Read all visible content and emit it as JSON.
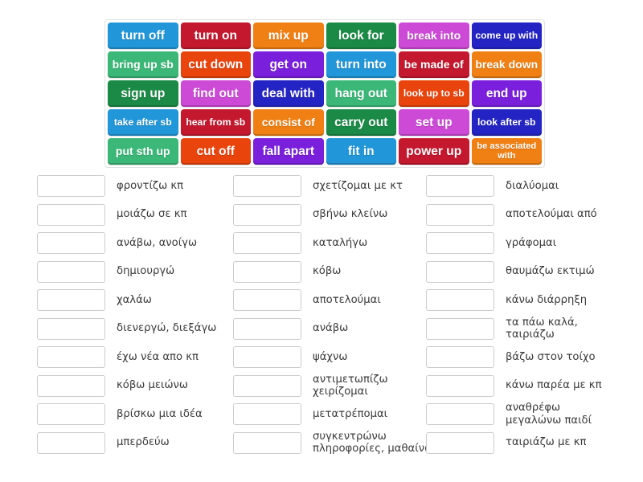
{
  "tile_grid": {
    "name": "phrasal-verbs-tile-grid",
    "rows": [
      [
        {
          "label": "turn off",
          "color": "#2196d8",
          "size": "lg"
        },
        {
          "label": "turn on",
          "color": "#c4182e",
          "size": "lg"
        },
        {
          "label": "mix up",
          "color": "#f08013",
          "size": "lg"
        },
        {
          "label": "look for",
          "color": "#1b8a46",
          "size": "lg"
        },
        {
          "label": "break into",
          "color": "#cc4ad6",
          "size": "md"
        },
        {
          "label": "come up with",
          "color": "#2424c4",
          "size": "sm"
        }
      ],
      [
        {
          "label": "bring up sb",
          "color": "#3bb878",
          "size": "md"
        },
        {
          "label": "cut down",
          "color": "#ea440d",
          "size": "lg"
        },
        {
          "label": "get on",
          "color": "#7a1fdb",
          "size": "lg"
        },
        {
          "label": "turn into",
          "color": "#2196d8",
          "size": "lg"
        },
        {
          "label": "be made of",
          "color": "#c4182e",
          "size": "md"
        },
        {
          "label": "break down",
          "color": "#f08013",
          "size": "md"
        }
      ],
      [
        {
          "label": "sign up",
          "color": "#1b8a46",
          "size": "lg"
        },
        {
          "label": "find out",
          "color": "#cc4ad6",
          "size": "lg"
        },
        {
          "label": "deal with",
          "color": "#2424c4",
          "size": "lg"
        },
        {
          "label": "hang out",
          "color": "#3bb878",
          "size": "lg"
        },
        {
          "label": "look up to sb",
          "color": "#ea440d",
          "size": "sm"
        },
        {
          "label": "end up",
          "color": "#7a1fdb",
          "size": "lg"
        }
      ],
      [
        {
          "label": "take after sb",
          "color": "#2196d8",
          "size": "sm"
        },
        {
          "label": "hear from sb",
          "color": "#c4182e",
          "size": "sm"
        },
        {
          "label": "consist of",
          "color": "#f08013",
          "size": "md"
        },
        {
          "label": "carry out",
          "color": "#1b8a46",
          "size": "lg"
        },
        {
          "label": "set up",
          "color": "#cc4ad6",
          "size": "lg"
        },
        {
          "label": "look after sb",
          "color": "#2424c4",
          "size": "sm"
        }
      ],
      [
        {
          "label": "put sth up",
          "color": "#3bb878",
          "size": "md"
        },
        {
          "label": "cut off",
          "color": "#ea440d",
          "size": "lg"
        },
        {
          "label": "fall apart",
          "color": "#7a1fdb",
          "size": "lg"
        },
        {
          "label": "fit in",
          "color": "#2196d8",
          "size": "lg"
        },
        {
          "label": "power up",
          "color": "#c4182e",
          "size": "lg"
        },
        {
          "label": "be associated\nwith",
          "color": "#f08013",
          "size": "xs"
        }
      ]
    ]
  },
  "answers": {
    "columns": [
      {
        "name": "answer-column-1",
        "items": [
          {
            "value": "",
            "label": "φροντίζω κπ"
          },
          {
            "value": "",
            "label": "μοιάζω σε κπ"
          },
          {
            "value": "",
            "label": "ανάβω, ανοίγω"
          },
          {
            "value": "",
            "label": "δημιουργώ"
          },
          {
            "value": "",
            "label": "χαλάω"
          },
          {
            "value": "",
            "label": "διενεργώ, διεξάγω"
          },
          {
            "value": "",
            "label": "έχω νέα απο κπ"
          },
          {
            "value": "",
            "label": "κόβω μειώνω"
          },
          {
            "value": "",
            "label": "βρίσκω μια ιδέα"
          },
          {
            "value": "",
            "label": "μπερδεύω"
          }
        ]
      },
      {
        "name": "answer-column-2",
        "items": [
          {
            "value": "",
            "label": "σχετίζομαι με κτ"
          },
          {
            "value": "",
            "label": "σβήνω κλείνω"
          },
          {
            "value": "",
            "label": "καταλήγω"
          },
          {
            "value": "",
            "label": "κόβω"
          },
          {
            "value": "",
            "label": "αποτελούμαι"
          },
          {
            "value": "",
            "label": "ανάβω"
          },
          {
            "value": "",
            "label": "ψάχνω"
          },
          {
            "value": "",
            "label": "αντιμετωπίζω\nχειρίζομαι"
          },
          {
            "value": "",
            "label": "μετατρέπομαι"
          },
          {
            "value": "",
            "label": "συγκεντρώνω\nπληροφορίες, μαθαίνω"
          }
        ]
      },
      {
        "name": "answer-column-3",
        "items": [
          {
            "value": "",
            "label": "διαλύομαι"
          },
          {
            "value": "",
            "label": "αποτελούμαι από"
          },
          {
            "value": "",
            "label": "γράφομαι"
          },
          {
            "value": "",
            "label": "θαυμάζω εκτιμώ"
          },
          {
            "value": "",
            "label": "κάνω διάρρηξη"
          },
          {
            "value": "",
            "label": "τα πάω καλά, ταιριάζω"
          },
          {
            "value": "",
            "label": "βάζω στον τοίχο"
          },
          {
            "value": "",
            "label": "κάνω παρέα με κπ"
          },
          {
            "value": "",
            "label": "αναθρέφω\nμεγαλώνω παιδί"
          },
          {
            "value": "",
            "label": "ταιριάζω με κπ"
          }
        ]
      }
    ]
  },
  "theme": {
    "page_background": "#ffffff",
    "box_border": "#cccccc",
    "grid_border": "#e2e2e2",
    "label_text": "#3b3b3b"
  }
}
